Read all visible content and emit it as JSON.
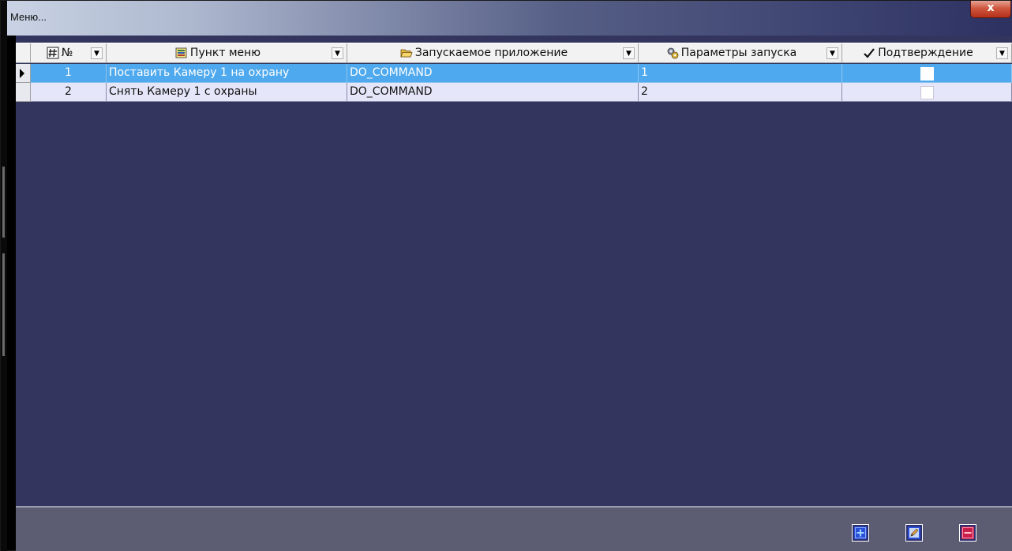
{
  "window": {
    "title": "Меню...",
    "close_label": "x"
  },
  "grid": {
    "columns": [
      {
        "label": "№",
        "icon": "hash-icon"
      },
      {
        "label": "Пункт меню",
        "icon": "menu-item-icon"
      },
      {
        "label": "Запускаемое приложение",
        "icon": "folder-open-icon"
      },
      {
        "label": "Параметры запуска",
        "icon": "gears-icon"
      },
      {
        "label": "Подтверждение",
        "icon": "checkmark-icon"
      }
    ],
    "rows": [
      {
        "num": "1",
        "item": "Поставить Камеру 1 на охрану",
        "app": "DO_COMMAND",
        "params": "1",
        "confirm": false,
        "selected": true
      },
      {
        "num": "2",
        "item": "Снять Камеру 1 с охраны",
        "app": "DO_COMMAND",
        "params": "2",
        "confirm": false,
        "selected": false
      }
    ]
  },
  "toolbar": {
    "buttons": [
      {
        "name": "add-button",
        "icon": "add-icon"
      },
      {
        "name": "edit-button",
        "icon": "edit-icon"
      },
      {
        "name": "delete-button",
        "icon": "delete-icon"
      }
    ]
  },
  "colors": {
    "background": "#33355e",
    "selected_row": "#4fa9ee",
    "normal_row": "#e6e6fa"
  }
}
